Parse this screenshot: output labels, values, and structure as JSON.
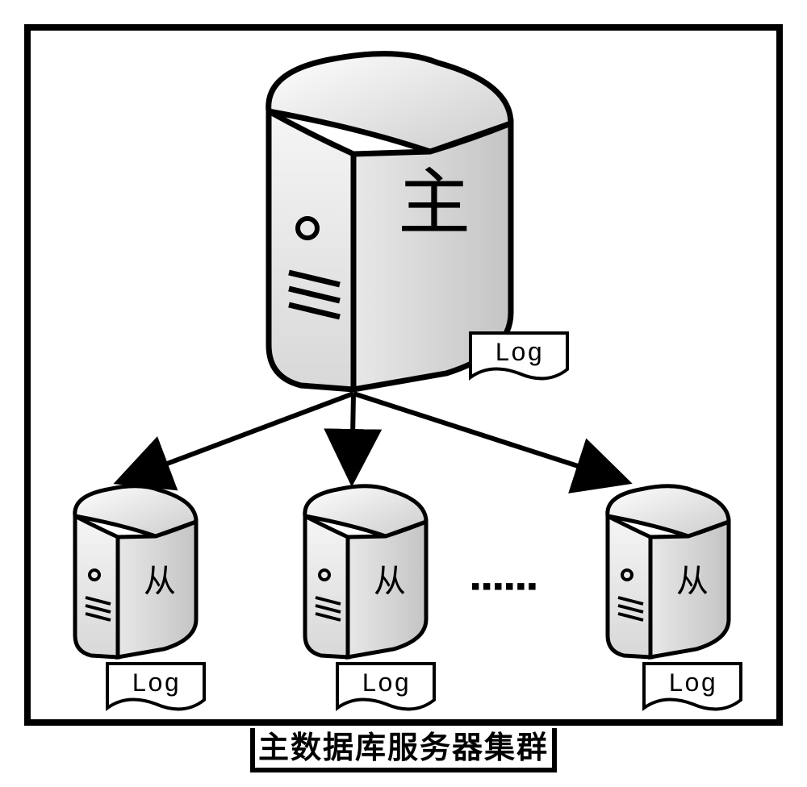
{
  "title": "主数据库服务器集群",
  "main_server": {
    "label": "主",
    "log": "Log"
  },
  "slaves": [
    {
      "label": "从",
      "log": "Log"
    },
    {
      "label": "从",
      "log": "Log"
    },
    {
      "label": "从",
      "log": "Log"
    }
  ],
  "ellipsis": "▪▪▪▪▪▪"
}
